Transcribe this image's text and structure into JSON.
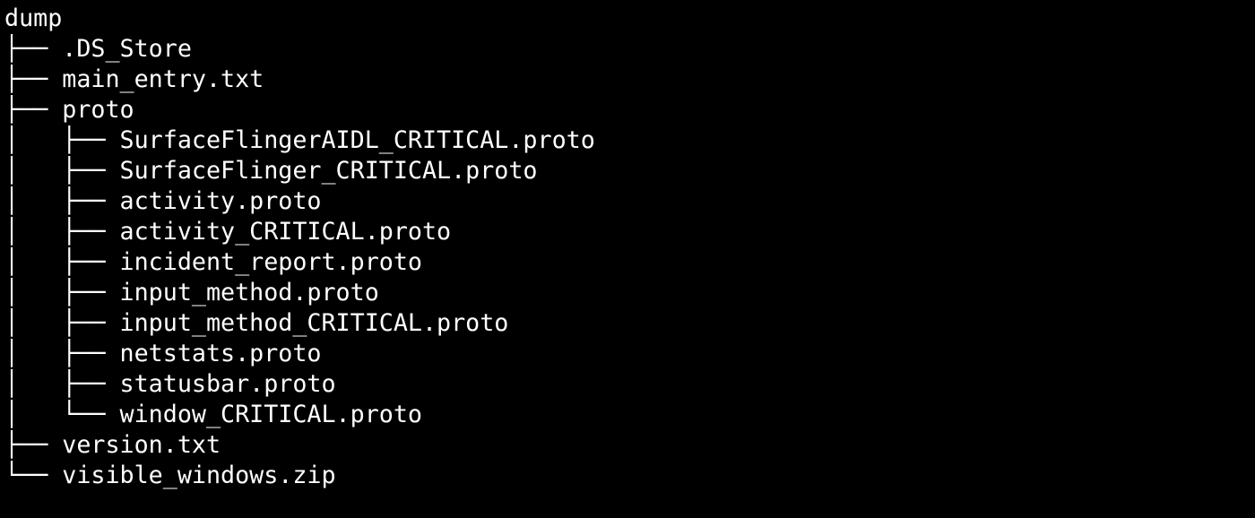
{
  "terminal": {
    "background_color": "#000000",
    "foreground_color": "#ffffff",
    "root_label": "dump"
  },
  "tree": {
    "root": "dump",
    "rows": [
      {
        "prefix": "",
        "label": "dump",
        "depth": 0,
        "kind": "directory",
        "last": false
      },
      {
        "prefix": "├── ",
        "label": ".DS_Store",
        "depth": 1,
        "kind": "file",
        "last": false
      },
      {
        "prefix": "├── ",
        "label": "main_entry.txt",
        "depth": 1,
        "kind": "file",
        "last": false
      },
      {
        "prefix": "├── ",
        "label": "proto",
        "depth": 1,
        "kind": "directory",
        "last": false
      },
      {
        "prefix": "│   ├── ",
        "label": "SurfaceFlingerAIDL_CRITICAL.proto",
        "depth": 2,
        "kind": "file",
        "last": false
      },
      {
        "prefix": "│   ├── ",
        "label": "SurfaceFlinger_CRITICAL.proto",
        "depth": 2,
        "kind": "file",
        "last": false
      },
      {
        "prefix": "│   ├── ",
        "label": "activity.proto",
        "depth": 2,
        "kind": "file",
        "last": false
      },
      {
        "prefix": "│   ├── ",
        "label": "activity_CRITICAL.proto",
        "depth": 2,
        "kind": "file",
        "last": false
      },
      {
        "prefix": "│   ├── ",
        "label": "incident_report.proto",
        "depth": 2,
        "kind": "file",
        "last": false
      },
      {
        "prefix": "│   ├── ",
        "label": "input_method.proto",
        "depth": 2,
        "kind": "file",
        "last": false
      },
      {
        "prefix": "│   ├── ",
        "label": "input_method_CRITICAL.proto",
        "depth": 2,
        "kind": "file",
        "last": false
      },
      {
        "prefix": "│   ├── ",
        "label": "netstats.proto",
        "depth": 2,
        "kind": "file",
        "last": false
      },
      {
        "prefix": "│   ├── ",
        "label": "statusbar.proto",
        "depth": 2,
        "kind": "file",
        "last": false
      },
      {
        "prefix": "│   └── ",
        "label": "window_CRITICAL.proto",
        "depth": 2,
        "kind": "file",
        "last": true
      },
      {
        "prefix": "├── ",
        "label": "version.txt",
        "depth": 1,
        "kind": "file",
        "last": false
      },
      {
        "prefix": "└── ",
        "label": "visible_windows.zip",
        "depth": 1,
        "kind": "file",
        "last": true
      }
    ]
  }
}
